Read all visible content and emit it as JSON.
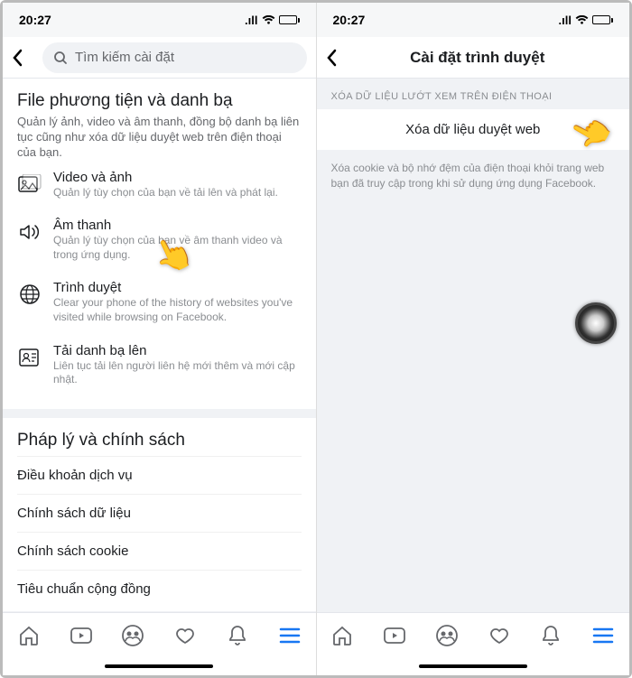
{
  "status_time": "20:27",
  "left": {
    "search_placeholder": "Tìm kiếm cài đặt",
    "section_title": "File phương tiện và danh bạ",
    "section_desc": "Quản lý ảnh, video và âm thanh, đồng bộ danh bạ liên tục cũng như xóa dữ liệu duyệt web trên điện thoại của bạn.",
    "items": [
      {
        "title": "Video và ảnh",
        "desc": "Quản lý tùy chọn của bạn về tải lên và phát lại."
      },
      {
        "title": "Âm thanh",
        "desc": "Quản lý tùy chọn của bạn về âm thanh video và trong ứng dụng."
      },
      {
        "title": "Trình duyệt",
        "desc": "Clear your phone of the history of websites you've visited while browsing on Facebook."
      },
      {
        "title": "Tải danh bạ lên",
        "desc": "Liên tục tải lên người liên hệ mới thêm và mới cập nhật."
      }
    ],
    "legal_title": "Pháp lý và chính sách",
    "legal_items": [
      "Điều khoản dịch vụ",
      "Chính sách dữ liệu",
      "Chính sách cookie",
      "Tiêu chuẩn cộng đồng"
    ]
  },
  "right": {
    "header_title": "Cài đặt trình duyệt",
    "section_label": "XÓA DỮ LIỆU LƯỚT XEM TRÊN ĐIỆN THOẠI",
    "action_label": "Xóa dữ liệu duyệt web",
    "info_text": "Xóa cookie và bộ nhớ đệm của điện thoại khỏi trang web bạn đã truy cập trong khi sử dụng ứng dụng Facebook."
  }
}
